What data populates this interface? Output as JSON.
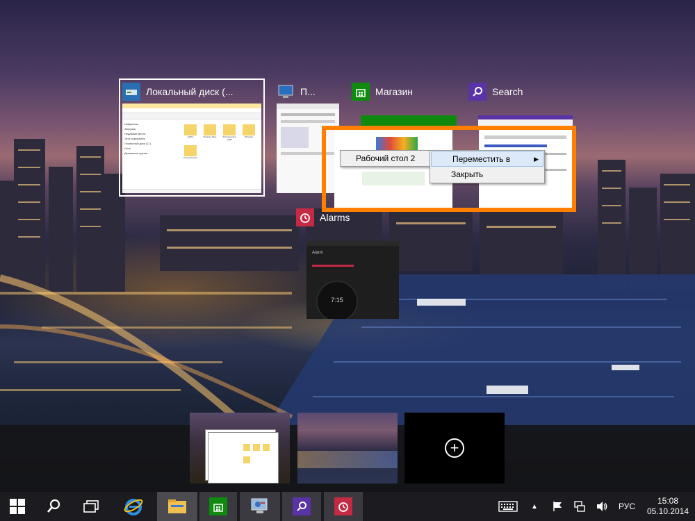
{
  "task_view": {
    "windows": [
      {
        "title": "Локальный диск (...",
        "icon": "drive-icon"
      },
      {
        "title": "П...",
        "icon": "computer-icon"
      },
      {
        "title": "Магазин",
        "icon": "store-icon"
      },
      {
        "title": "Search",
        "icon": "search-icon"
      },
      {
        "title": "Alarms",
        "icon": "alarm-clock-icon"
      }
    ],
    "explorer_thumb": {
      "sidebar": [
        "Избранное",
        "Загрузки",
        "Недавние места",
        "Этот компьютер",
        "Локальный диск (C:)",
        "Сеть",
        "Домашняя группа"
      ],
      "folders": [
        "AsPhy",
        "Program Files",
        "Program Files (x86)",
        "Windows",
        "Пользователи"
      ]
    },
    "alarm_thumb": {
      "header": "Alarm",
      "time": "7:15"
    }
  },
  "context_menu": {
    "submenu_item": "Рабочий стол 2",
    "items": [
      "Переместить в",
      "Закрыть"
    ]
  },
  "desktops": {
    "add_label": "+"
  },
  "taskbar": {
    "language": "РУС",
    "time": "15:08",
    "date": "05.10.2014"
  },
  "colors": {
    "highlight_orange": "#ff7f00",
    "store_green": "#0f8a0f",
    "search_purple": "#5a33a6",
    "alarm_red": "#c42a44",
    "taskbar": "#1c1c20"
  }
}
